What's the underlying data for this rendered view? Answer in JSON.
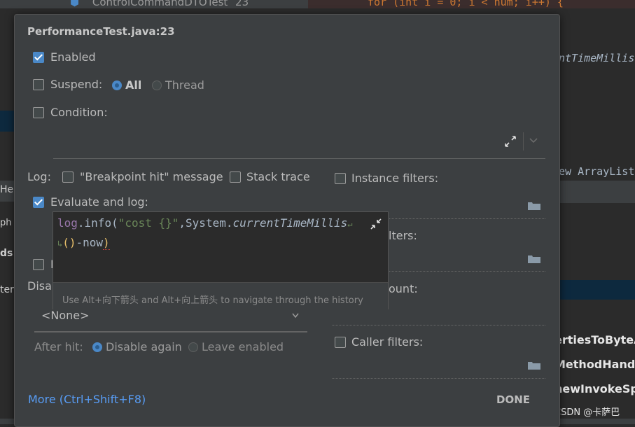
{
  "background": {
    "tab_title": "ControlCommandDTOTest",
    "tab_line": "23",
    "code_top": "for (int i = 0; i < num; i++) {",
    "code_right_1": "ntTimeMillis",
    "code_right_2": "ew ArrayList",
    "left_labels": [
      "He",
      "ph",
      "ds",
      "ter"
    ],
    "right_labels": [
      "ertiesToByteA",
      "MethodHandle",
      "newInvokeSpe"
    ],
    "watermark": "CSDN @卡萨巴"
  },
  "dialog": {
    "title": "PerformanceTest.java:23",
    "enabled_label": "Enabled",
    "enabled_checked": true,
    "suspend_label": "Suspend:",
    "suspend_checked": false,
    "suspend_options": [
      "All",
      "Thread"
    ],
    "suspend_selected": "All",
    "condition_label": "Condition:",
    "condition_checked": false,
    "log_label": "Log:",
    "breakpoint_hit_label": "\"Breakpoint hit\" message",
    "stack_trace_label": "Stack trace",
    "instance_filters_label": "Instance filters:",
    "evaluate_label": "Evaluate and log:",
    "evaluate_checked": true,
    "class_filters_partial": "lters:",
    "pass_count_partial": "ount:",
    "remove_partial": "I",
    "disable_partial": "Disab",
    "dropdown_value": "<None>",
    "after_hit_label": "After hit:",
    "after_hit_options": [
      "Disable again",
      "Leave enabled"
    ],
    "after_hit_selected": "Disable again",
    "caller_filters_label": "Caller filters:",
    "more_link": "More (Ctrl+Shift+F8)",
    "done_label": "DONE"
  },
  "popup": {
    "code_line_1_a": "log",
    "code_line_1_b": ".info(",
    "code_line_1_c": "\"cost {}\"",
    "code_line_1_d": ",System.",
    "code_line_1_e": "currentTimeMillis",
    "code_line_2_a": "()",
    "code_line_2_b": "-now",
    "code_line_2_c": ")",
    "hint": "Use Alt+向下箭头 and Alt+向上箭头 to navigate through the history"
  }
}
